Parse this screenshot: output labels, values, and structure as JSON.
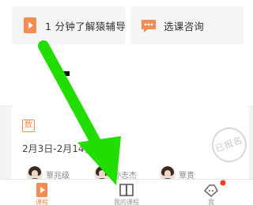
{
  "colors": {
    "accent": "#f28c52",
    "arrow": "#22dd00",
    "badge": "#ff3b1f"
  },
  "quick_actions": [
    {
      "label": "1 分钟了解猿辅导",
      "icon": "play-book-icon"
    },
    {
      "label": "选课咨询",
      "icon": "chat-bubble-icon"
    }
  ],
  "course_card": {
    "subject": "数",
    "date_range": "2月3日-2月14日",
    "status_stamp": "已报名",
    "teachers": [
      {
        "name": "覃兆级"
      },
      {
        "name": "孙志杰"
      },
      {
        "name": "覃贵"
      }
    ]
  },
  "tabbar": {
    "tabs": [
      {
        "label": "课程",
        "icon": "play-book-icon",
        "active": true
      },
      {
        "label": "我的课程",
        "icon": "open-book-icon",
        "active": false
      },
      {
        "label": "我",
        "icon": "face-icon",
        "active": false,
        "has_badge": true
      }
    ]
  }
}
